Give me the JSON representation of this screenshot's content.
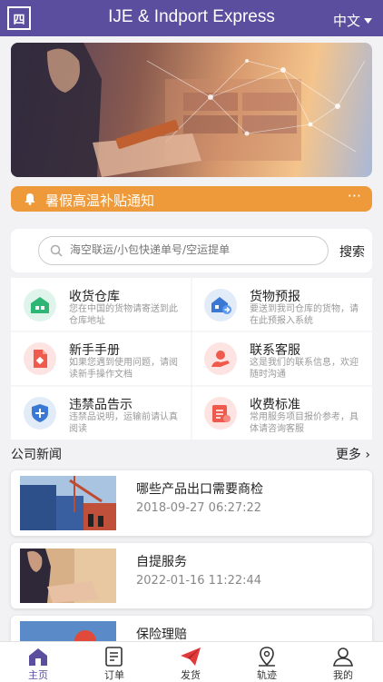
{
  "header": {
    "logo_text": "四",
    "title": "IJE & Indport Express",
    "language": "中文"
  },
  "notice": {
    "text": "暑假高温补贴通知",
    "more": "···"
  },
  "search": {
    "placeholder": "海空联运/小包快递单号/空运提单",
    "button": "搜索"
  },
  "services": [
    {
      "title": "收货仓库",
      "desc": "您在中国的货物请寄送到此仓库地址"
    },
    {
      "title": "货物预报",
      "desc": "要送到我司仓库的货物，请在此预报入系统"
    },
    {
      "title": "新手手册",
      "desc": "如果您遇到使用问题，请阅读新手操作文档"
    },
    {
      "title": "联系客服",
      "desc": "这是我们的联系信息，欢迎随时沟通"
    },
    {
      "title": "违禁品告示",
      "desc": "违禁品说明，运输前请认真阅读"
    },
    {
      "title": "收费标准",
      "desc": "常用服务项目报价参考，具体请咨询客服"
    }
  ],
  "news": {
    "title": "公司新闻",
    "more": "更多 ›",
    "items": [
      {
        "title": "哪些产品出口需要商检",
        "date": "2018-09-27 06:27:22"
      },
      {
        "title": "自提服务",
        "date": "2022-01-16 11:22:44"
      },
      {
        "title": "保险理赔",
        "date": ""
      }
    ]
  },
  "tabbar": [
    {
      "label": "主页",
      "active": true
    },
    {
      "label": "订单",
      "active": false
    },
    {
      "label": "发货",
      "active": false
    },
    {
      "label": "轨迹",
      "active": false
    },
    {
      "label": "我的",
      "active": false
    }
  ],
  "colors": {
    "brand": "#5b4e9e",
    "notice": "#ee9a3a",
    "active_tab": "#5b4e9e",
    "send_icon": "#e23a3a"
  }
}
